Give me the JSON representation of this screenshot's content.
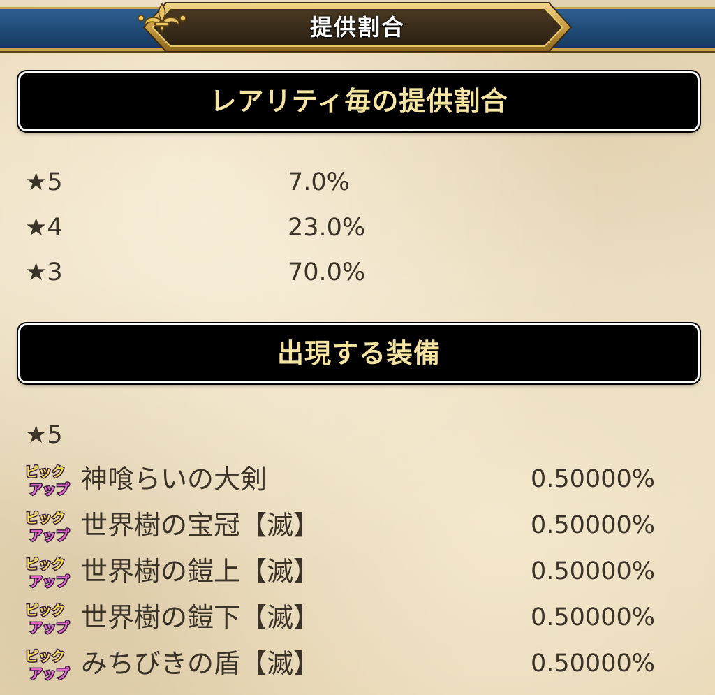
{
  "header": {
    "title": "提供割合"
  },
  "sections": {
    "rarity_title": "レアリティ毎の提供割合",
    "equipment_title": "出現する装備"
  },
  "rarity": [
    {
      "label": "★5",
      "rate": "7.0%"
    },
    {
      "label": "★4",
      "rate": "23.0%"
    },
    {
      "label": "★3",
      "rate": "70.0%"
    }
  ],
  "equipment": {
    "heading": "★5",
    "badge_text": [
      "ピック",
      "アップ"
    ],
    "items": [
      {
        "name": "神喰らいの大剣",
        "rate": "0.50000%"
      },
      {
        "name": "世界樹の宝冠【滅】",
        "rate": "0.50000%"
      },
      {
        "name": "世界樹の鎧上【滅】",
        "rate": "0.50000%"
      },
      {
        "name": "世界樹の鎧下【滅】",
        "rate": "0.50000%"
      },
      {
        "name": "みちびきの盾【滅】",
        "rate": "0.50000%"
      }
    ]
  },
  "colors": {
    "header_blue": "#1f4a76",
    "gold_trim": "#c8a34e",
    "banner_bg": "#000000",
    "banner_text": "#f4e3a1",
    "body_text": "#3b3228",
    "parchment": "#e9dcc0",
    "badge_yellow": "#f5e15a",
    "badge_pink": "#e96ad0"
  },
  "icons": {
    "header_ornament": "fleur-de-lis-icon",
    "pickup_badge": "pickup-badge-icon"
  }
}
